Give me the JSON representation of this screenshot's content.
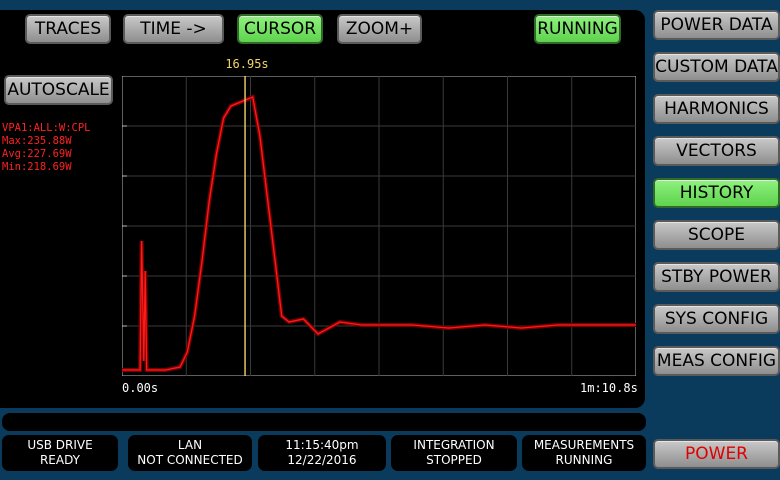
{
  "toolbar": {
    "traces": "TRACES",
    "time": "TIME ->",
    "cursor": "CURSOR",
    "zoom": "ZOOM+",
    "running": "RUNNING",
    "autoscale": "AUTOSCALE"
  },
  "sidebar": {
    "items": [
      "POWER DATA",
      "CUSTOM DATA",
      "HARMONICS",
      "VECTORS",
      "HISTORY",
      "SCOPE",
      "STBY POWER",
      "SYS CONFIG",
      "MEAS CONFIG"
    ],
    "active": "HISTORY",
    "power": "POWER"
  },
  "trace": {
    "name": "VPA1:ALL:W:CPL",
    "max": "Max:235.88W",
    "avg": "Avg:227.69W",
    "min": "Min:218.69W"
  },
  "cursor_label": "16.95s",
  "axis": {
    "start": "0.00s",
    "end": "1m:10.8s"
  },
  "status": [
    {
      "l1": "USB DRIVE",
      "l2": "READY"
    },
    {
      "l1": "LAN",
      "l2": "NOT CONNECTED"
    },
    {
      "l1": "11:15:40pm",
      "l2": "12/22/2016"
    },
    {
      "l1": "INTEGRATION",
      "l2": "STOPPED"
    },
    {
      "l1": "MEASUREMENTS",
      "l2": "RUNNING"
    }
  ],
  "colors": {
    "trace": "#ff1a1a",
    "cursor": "#f2d46b",
    "grid": "#3a3a3a",
    "active_button": "#6ee05c"
  },
  "chart_data": {
    "type": "line",
    "xlim_seconds": [
      0,
      70.8
    ],
    "cursor_x_seconds": 16.95,
    "x": [
      0,
      2.5,
      2.7,
      3.0,
      3.2,
      3.4,
      3.6,
      4.0,
      6,
      8,
      9,
      10,
      11,
      12,
      13,
      14,
      15,
      16,
      17,
      18,
      19,
      20,
      21,
      22,
      23,
      25,
      27,
      30,
      33,
      35,
      40,
      45,
      50,
      55,
      60,
      65,
      70.8
    ],
    "y": [
      0.02,
      0.02,
      0.45,
      0.05,
      0.35,
      0.02,
      0.02,
      0.02,
      0.02,
      0.03,
      0.08,
      0.2,
      0.38,
      0.58,
      0.74,
      0.86,
      0.9,
      0.91,
      0.92,
      0.93,
      0.8,
      0.6,
      0.4,
      0.2,
      0.18,
      0.19,
      0.14,
      0.18,
      0.17,
      0.17,
      0.17,
      0.16,
      0.17,
      0.16,
      0.17,
      0.17,
      0.17
    ]
  }
}
